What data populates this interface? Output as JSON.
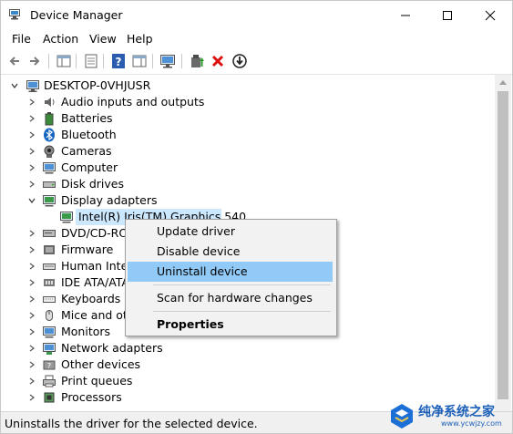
{
  "window": {
    "title": "Device Manager"
  },
  "window_controls": {
    "minimize": "minimize",
    "maximize": "maximize",
    "close": "close"
  },
  "menubar": [
    "File",
    "Action",
    "View",
    "Help"
  ],
  "toolbar": {
    "buttons": [
      "back-arrow-icon",
      "forward-arrow-icon",
      "show-hide-console-tree-icon",
      "properties-icon",
      "help-icon",
      "action-pane-icon",
      "monitor-icon",
      "update-driver-icon",
      "uninstall-icon",
      "download-icon"
    ]
  },
  "tree": {
    "root": "DESKTOP-0VHJUSR",
    "categories": [
      "Audio inputs and outputs",
      "Batteries",
      "Bluetooth",
      "Cameras",
      "Computer",
      "Disk drives",
      "Display adapters",
      "DVD/CD-ROM drives",
      "Firmware",
      "Human Interface Devices",
      "IDE ATA/ATAPI controllers",
      "Keyboards",
      "Mice and other pointing devices",
      "Monitors",
      "Network adapters",
      "Other devices",
      "Print queues",
      "Processors"
    ],
    "selected_device": "Intel(R) Iris(TM) Graphics 540"
  },
  "context_menu": {
    "items": [
      "Update driver",
      "Disable device",
      "Uninstall device",
      "Scan for hardware changes",
      "Properties"
    ],
    "hovered": "Uninstall device"
  },
  "status_bar": {
    "text": "Uninstalls the driver for the selected device."
  },
  "watermark": {
    "text_cn": "纯净系统之家",
    "url": "www.ycwjzy.com"
  },
  "colors": {
    "selection": "#cce8ff",
    "menu_hover": "#91c9f7",
    "close_red": "#e81123"
  }
}
